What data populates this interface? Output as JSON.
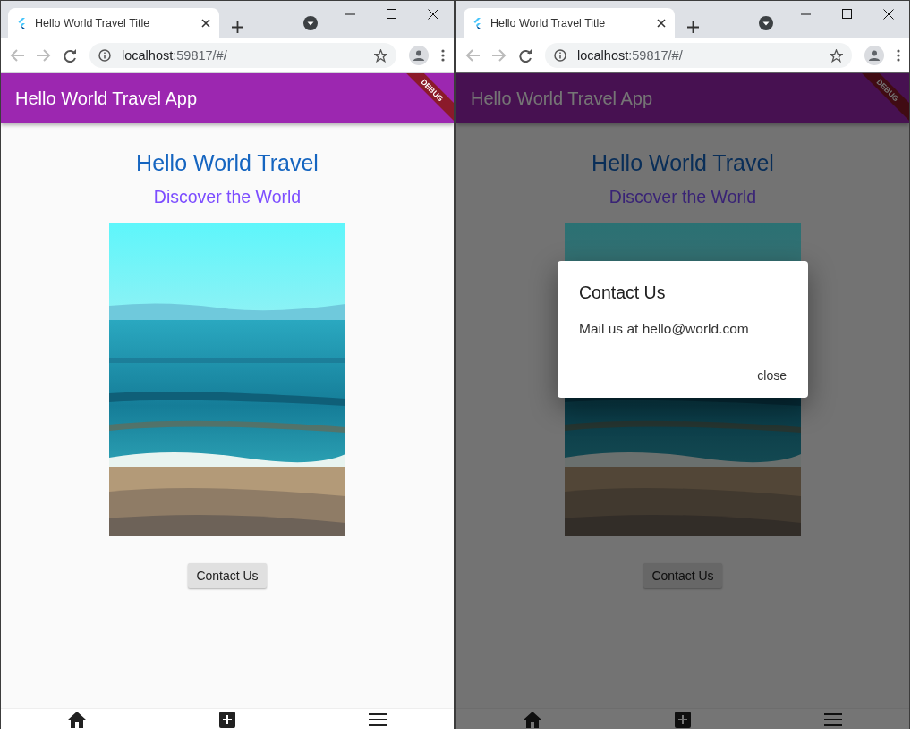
{
  "windows": [
    {
      "tab_title": "Hello World Travel Title",
      "url": {
        "host": "localhost",
        "rest": ":59817/#/"
      },
      "app_bar": {
        "title": "Hello World Travel App",
        "banner": "DEBUG"
      },
      "page": {
        "heading": "Hello World Travel",
        "subheading": "Discover the World",
        "button": "Contact Us"
      },
      "bottom_nav": [
        {
          "kind": "home"
        },
        {
          "kind": "add"
        },
        {
          "kind": "menu"
        }
      ]
    },
    {
      "tab_title": "Hello World Travel Title",
      "url": {
        "host": "localhost",
        "rest": ":59817/#/"
      },
      "app_bar": {
        "title": "Hello World Travel App",
        "banner": "DEBUG"
      },
      "page": {
        "heading": "Hello World Travel",
        "subheading": "Discover the World",
        "button": "Contact Us"
      },
      "bottom_nav": [
        {
          "kind": "home"
        },
        {
          "kind": "add"
        },
        {
          "kind": "menu"
        }
      ],
      "dialog": {
        "title": "Contact Us",
        "message": "Mail us at hello@world.com",
        "action": "close"
      }
    }
  ]
}
